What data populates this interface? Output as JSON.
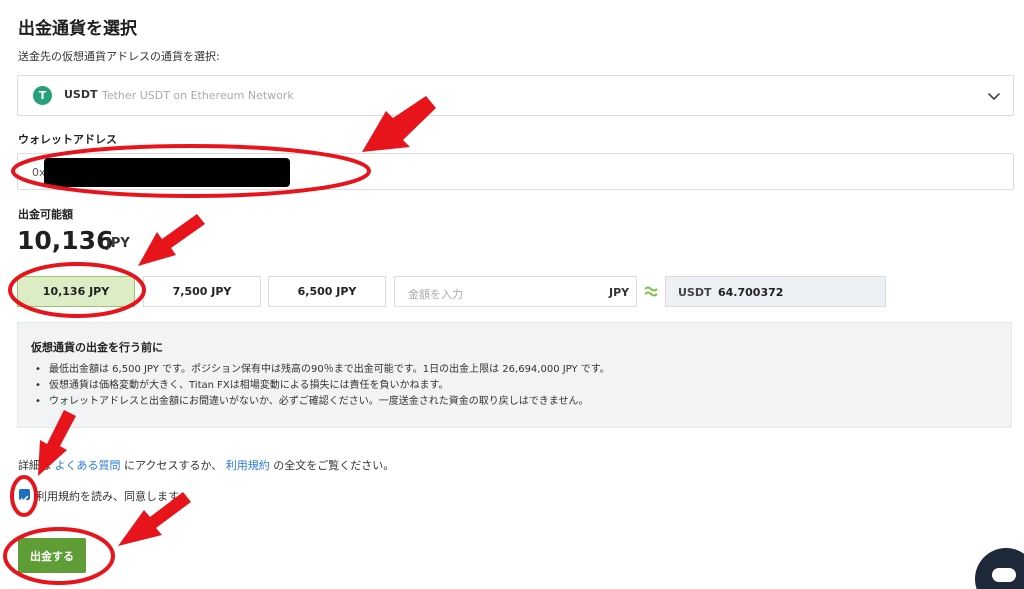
{
  "page": {
    "title": "出金通貨を選択",
    "subtitle": "送金先の仮想通貨アドレスの通貨を選択:"
  },
  "currency_select": {
    "code": "USDT",
    "name": "Tether USDT on Ethereum Network",
    "logo_letter": "T"
  },
  "wallet": {
    "label": "ウォレットアドレス",
    "value_prefix": "0x"
  },
  "available": {
    "label": "出金可能額",
    "amount": "10,136",
    "currency": "JPY"
  },
  "amount_options": [
    {
      "label": "10,136 JPY",
      "selected": true
    },
    {
      "label": "7,500 JPY",
      "selected": false
    },
    {
      "label": "6,500 JPY",
      "selected": false
    }
  ],
  "amount_input": {
    "placeholder": "金額を入力",
    "unit": "JPY"
  },
  "conversion": {
    "code": "USDT",
    "value": "64.700372"
  },
  "notice": {
    "title": "仮想通貨の出金を行う前に",
    "items": [
      "最低出金額は 6,500 JPY です。ポジション保有中は残高の90％まで出金可能です。1日の出金上限は 26,694,000 JPY です。",
      "仮想通貨は価格変動が大きく、Titan FXは相場変動による損失には責任を負いかねます。",
      "ウォレットアドレスと出金額にお間違いがないか、必ずご確認ください。一度送金された資金の取り戻しはできません。"
    ]
  },
  "terms": {
    "prefix": "詳細は",
    "faq_link": "よくある質問",
    "middle": "にアクセスするか、",
    "terms_link": "利用規約",
    "suffix": "の全文をご覧ください。",
    "checkbox_label": "利用規約を読み、同意します",
    "checked": true
  },
  "submit": {
    "label": "出金する"
  },
  "colors": {
    "primary_green": "#5f9e36",
    "selected_bg": "#dcecc4",
    "link_blue": "#2a7ad6",
    "annotation_red": "#e8141c",
    "usdt_green": "#26a17b"
  }
}
